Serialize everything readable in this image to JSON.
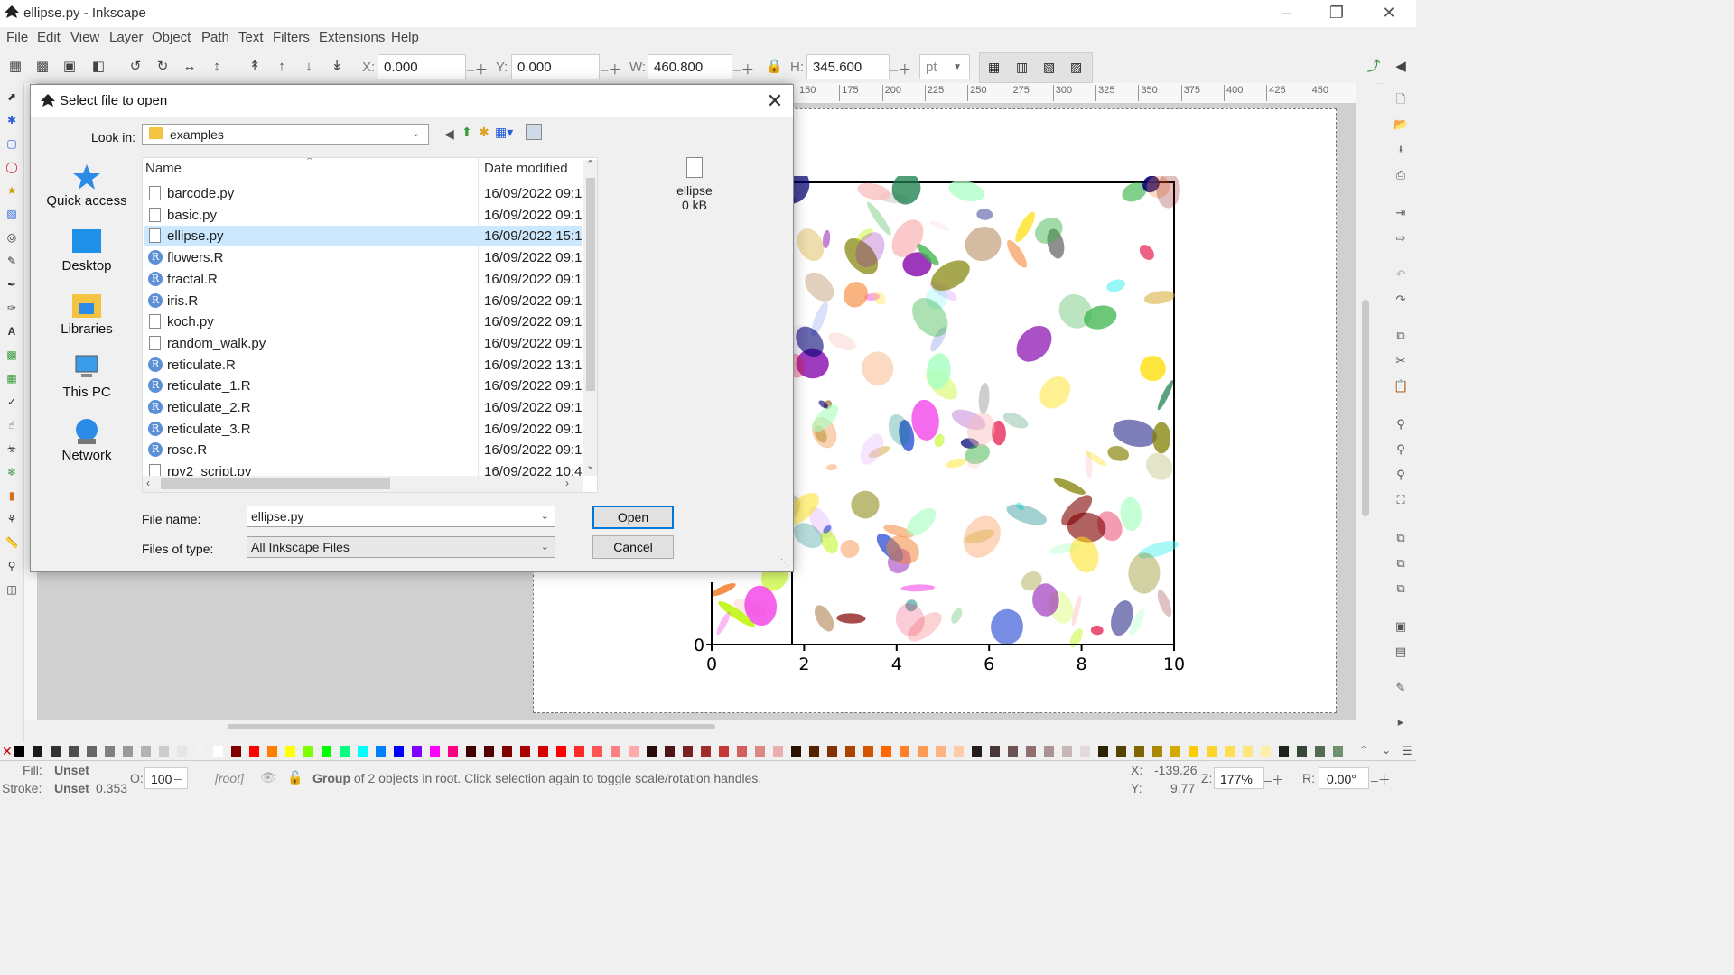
{
  "window": {
    "title": "ellipse.py - Inkscape"
  },
  "menu": [
    "File",
    "Edit",
    "View",
    "Layer",
    "Object",
    "Path",
    "Text",
    "Filters",
    "Extensions",
    "Help"
  ],
  "toolbar": {
    "x_label": "X:",
    "x_value": "0.000",
    "y_label": "Y:",
    "y_value": "0.000",
    "w_label": "W:",
    "w_value": "460.800",
    "h_label": "H:",
    "h_value": "345.600",
    "unit": "pt"
  },
  "ruler": {
    "ticks": [
      "150",
      "175",
      "200",
      "225",
      "250",
      "275",
      "300",
      "325",
      "350",
      "375",
      "400",
      "425",
      "450"
    ]
  },
  "dialog": {
    "title": "Select file to open",
    "look_in_label": "Look in:",
    "look_in_value": "examples",
    "places": [
      "Quick access",
      "Desktop",
      "Libraries",
      "This PC",
      "Network"
    ],
    "columns": {
      "name": "Name",
      "date": "Date modified"
    },
    "files": [
      {
        "name": "barcode.py",
        "date": "16/09/2022 09:1",
        "type": "py"
      },
      {
        "name": "basic.py",
        "date": "16/09/2022 09:1",
        "type": "py"
      },
      {
        "name": "ellipse.py",
        "date": "16/09/2022 15:1",
        "type": "py",
        "selected": true
      },
      {
        "name": "flowers.R",
        "date": "16/09/2022 09:1",
        "type": "R"
      },
      {
        "name": "fractal.R",
        "date": "16/09/2022 09:1",
        "type": "R"
      },
      {
        "name": "iris.R",
        "date": "16/09/2022 09:1",
        "type": "R"
      },
      {
        "name": "koch.py",
        "date": "16/09/2022 09:1",
        "type": "py"
      },
      {
        "name": "random_walk.py",
        "date": "16/09/2022 09:1",
        "type": "py"
      },
      {
        "name": "reticulate.R",
        "date": "16/09/2022 13:1",
        "type": "R"
      },
      {
        "name": "reticulate_1.R",
        "date": "16/09/2022 09:1",
        "type": "R"
      },
      {
        "name": "reticulate_2.R",
        "date": "16/09/2022 09:1",
        "type": "R"
      },
      {
        "name": "reticulate_3.R",
        "date": "16/09/2022 09:1",
        "type": "R"
      },
      {
        "name": "rose.R",
        "date": "16/09/2022 09:1",
        "type": "R"
      },
      {
        "name": "rpy2_script.py",
        "date": "16/09/2022 10:4",
        "type": "py"
      }
    ],
    "preview": {
      "name": "ellipse",
      "size": "0 kB"
    },
    "file_name_label": "File name:",
    "file_name_value": "ellipse.py",
    "file_type_label": "Files of type:",
    "file_type_value": "All Inkscape Files",
    "open_label": "Open",
    "cancel_label": "Cancel"
  },
  "plot": {
    "x_ticks": [
      "0",
      "2",
      "4",
      "6",
      "8",
      "10"
    ],
    "y_tick": "0"
  },
  "status": {
    "fill_label": "Fill:",
    "fill_value": "Unset",
    "stroke_label": "Stroke:",
    "stroke_value": "Unset",
    "stroke_width": "0.353",
    "opacity_label": "O:",
    "opacity_value": "100",
    "layer": "[root]",
    "message_bold": "Group",
    "message_rest": " of 2 objects in root. Click selection again to toggle scale/rotation handles.",
    "cursor_x_label": "X:",
    "cursor_x": "-139.26",
    "cursor_y_label": "Y:",
    "cursor_y": "9.77",
    "zoom_label": "Z:",
    "zoom": "177%",
    "rotate_label": "R:",
    "rotate": "0.00°"
  },
  "palette": [
    "#000000",
    "#1a1a1a",
    "#333333",
    "#4d4d4d",
    "#666666",
    "#808080",
    "#999999",
    "#b3b3b3",
    "#cccccc",
    "#e6e6e6",
    "#f2f2f2",
    "#ffffff",
    "#800000",
    "#ff0000",
    "#ff8000",
    "#ffff00",
    "#80ff00",
    "#00ff00",
    "#00ff80",
    "#00ffff",
    "#0080ff",
    "#0000ff",
    "#8000ff",
    "#ff00ff",
    "#ff0080",
    "#400000",
    "#550000",
    "#800000",
    "#aa0000",
    "#d40000",
    "#ff0000",
    "#ff2a2a",
    "#ff5555",
    "#ff8080",
    "#ffaaaa",
    "#280b0b",
    "#501616",
    "#782121",
    "#a02c2c",
    "#c83737",
    "#d35f5f",
    "#de8787",
    "#e9afaf",
    "#2b1100",
    "#552200",
    "#803300",
    "#aa4400",
    "#d45500",
    "#ff6600",
    "#ff7f2a",
    "#ff9955",
    "#ffb380",
    "#ffccaa",
    "#241c1c",
    "#483737",
    "#6c5353",
    "#916f6f",
    "#ac9393",
    "#c8b7b7",
    "#e3dbdb",
    "#2b2200",
    "#554400",
    "#806600",
    "#aa8800",
    "#d4aa00",
    "#ffcc00",
    "#ffd42a",
    "#ffdd55",
    "#ffe680",
    "#ffeeaa",
    "#1c241c",
    "#374837",
    "#536c53",
    "#6f916f"
  ]
}
